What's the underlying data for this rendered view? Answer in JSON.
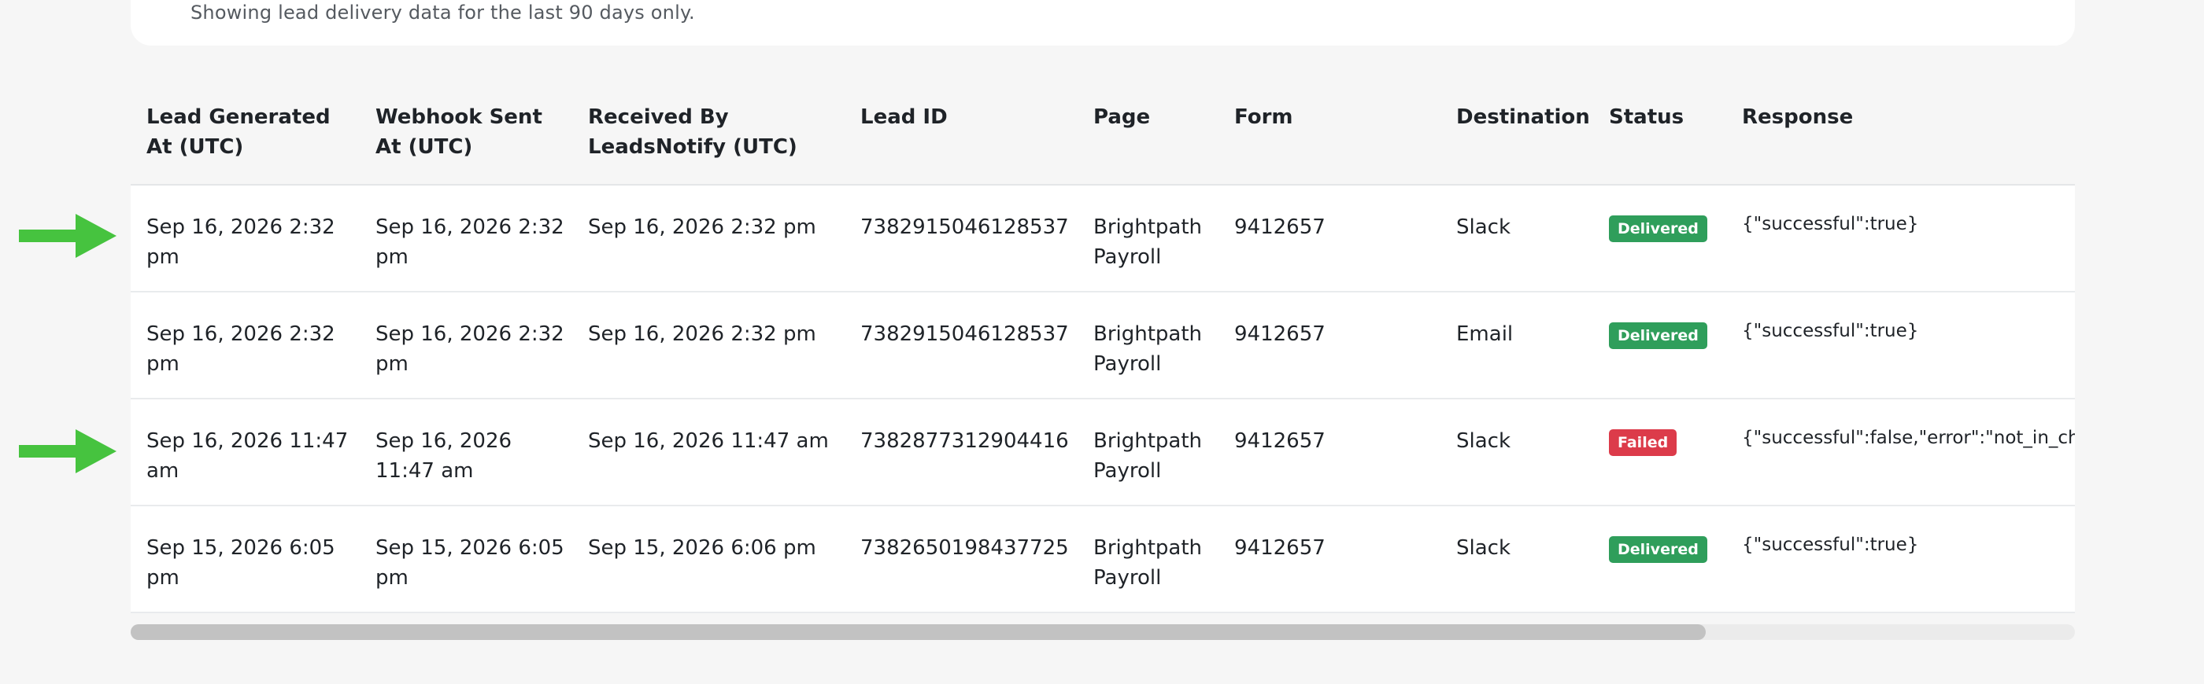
{
  "notice": {
    "text": "Showing lead delivery data for the last 90 days only."
  },
  "table": {
    "columns": [
      "Lead Generated At (UTC)",
      "Webhook Sent At (UTC)",
      "Received By LeadsNotify (UTC)",
      "Lead ID",
      "Page",
      "Form",
      "Destination",
      "Status",
      "Response"
    ],
    "rows": [
      {
        "lead_generated_at": "Sep 16, 2026 2:32 pm",
        "webhook_sent_at": "Sep 16, 2026 2:32 pm",
        "received_at": "Sep 16, 2026 2:32 pm",
        "lead_id": "7382915046128537",
        "page": "Brightpath Payroll",
        "form": "9412657",
        "destination": "Slack",
        "status": "Delivered",
        "response": "{\"successful\":true}"
      },
      {
        "lead_generated_at": "Sep 16, 2026 2:32 pm",
        "webhook_sent_at": "Sep 16, 2026 2:32 pm",
        "received_at": "Sep 16, 2026 2:32 pm",
        "lead_id": "7382915046128537",
        "page": "Brightpath Payroll",
        "form": "9412657",
        "destination": "Email",
        "status": "Delivered",
        "response": "{\"successful\":true}"
      },
      {
        "lead_generated_at": "Sep 16, 2026 11:47 am",
        "webhook_sent_at": "Sep 16, 2026 11:47 am",
        "received_at": "Sep 16, 2026 11:47 am",
        "lead_id": "7382877312904416",
        "page": "Brightpath Payroll",
        "form": "9412657",
        "destination": "Slack",
        "status": "Failed",
        "response": "{\"successful\":false,\"error\":\"not_in_cha"
      },
      {
        "lead_generated_at": "Sep 15, 2026 6:05 pm",
        "webhook_sent_at": "Sep 15, 2026 6:05 pm",
        "received_at": "Sep 15, 2026 6:06 pm",
        "lead_id": "7382650198437725",
        "page": "Brightpath Payroll",
        "form": "9412657",
        "destination": "Slack",
        "status": "Delivered",
        "response": "{\"successful\":true}"
      }
    ]
  },
  "status_colors": {
    "Delivered": "#2f9e5b",
    "Failed": "#dc3b4a"
  },
  "annotations": {
    "arrow_color": "#46c33f",
    "arrow_icon": "arrow-right-icon",
    "highlighted_rows": [
      0,
      2
    ]
  },
  "scrollbar": {
    "horizontal_position_fraction": 0.81
  }
}
